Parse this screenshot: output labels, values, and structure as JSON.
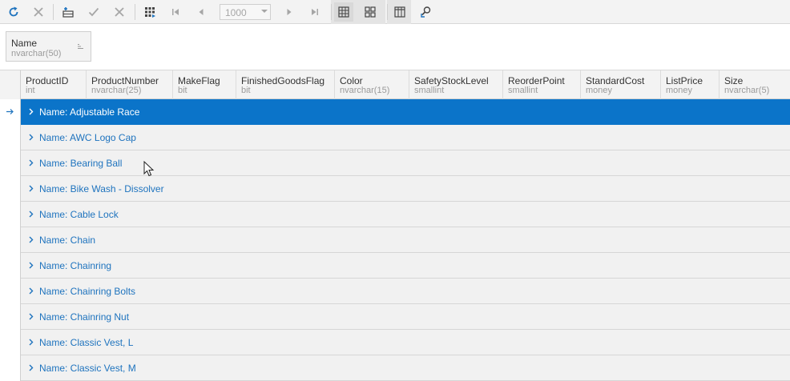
{
  "toolbar": {
    "buttons": [
      {
        "name": "refresh-button",
        "icon": "refresh-icon"
      },
      {
        "name": "cancel-refresh-button",
        "icon": "close-icon"
      },
      {
        "name": "add-row-button",
        "icon": "add-row-icon"
      },
      {
        "name": "apply-changes-button",
        "icon": "check-icon"
      },
      {
        "name": "discard-changes-button",
        "icon": "close-icon"
      },
      {
        "name": "fetch-all-button",
        "icon": "grid-fetch-icon"
      },
      {
        "name": "first-page-button",
        "icon": "first-page-icon"
      },
      {
        "name": "previous-page-button",
        "icon": "previous-icon"
      },
      {
        "name": "next-page-button",
        "icon": "next-icon"
      },
      {
        "name": "last-page-button",
        "icon": "last-page-icon"
      },
      {
        "name": "grid-view-button",
        "icon": "grid-icon"
      },
      {
        "name": "card-view-button",
        "icon": "card-view-icon"
      },
      {
        "name": "column-chooser-button",
        "icon": "columns-icon"
      },
      {
        "name": "find-button",
        "icon": "search-icon"
      }
    ],
    "page_size": "1000"
  },
  "group_panel": {
    "chip": {
      "name": "Name",
      "type": "nvarchar(50)"
    }
  },
  "columns": [
    {
      "name": "ProductID",
      "type": "int"
    },
    {
      "name": "ProductNumber",
      "type": "nvarchar(25)"
    },
    {
      "name": "MakeFlag",
      "type": "bit"
    },
    {
      "name": "FinishedGoodsFlag",
      "type": "bit"
    },
    {
      "name": "Color",
      "type": "nvarchar(15)"
    },
    {
      "name": "SafetyStockLevel",
      "type": "smallint"
    },
    {
      "name": "ReorderPoint",
      "type": "smallint"
    },
    {
      "name": "StandardCost",
      "type": "money"
    },
    {
      "name": "ListPrice",
      "type": "money"
    },
    {
      "name": "Size",
      "type": "nvarchar(5)"
    }
  ],
  "groups": [
    "Name: Adjustable Race",
    "Name: AWC Logo Cap",
    "Name: Bearing Ball",
    "Name: Bike Wash - Dissolver",
    "Name: Cable Lock",
    "Name: Chain",
    "Name: Chainring",
    "Name: Chainring Bolts",
    "Name: Chainring Nut",
    "Name: Classic Vest, L",
    "Name: Classic Vest, M"
  ],
  "selected_group_index": 0,
  "colors": {
    "selection": "#0b74c9",
    "link_text": "#1e73be",
    "toolbar_icon": "#1e73be",
    "disabled_icon": "#a6a6a6"
  }
}
